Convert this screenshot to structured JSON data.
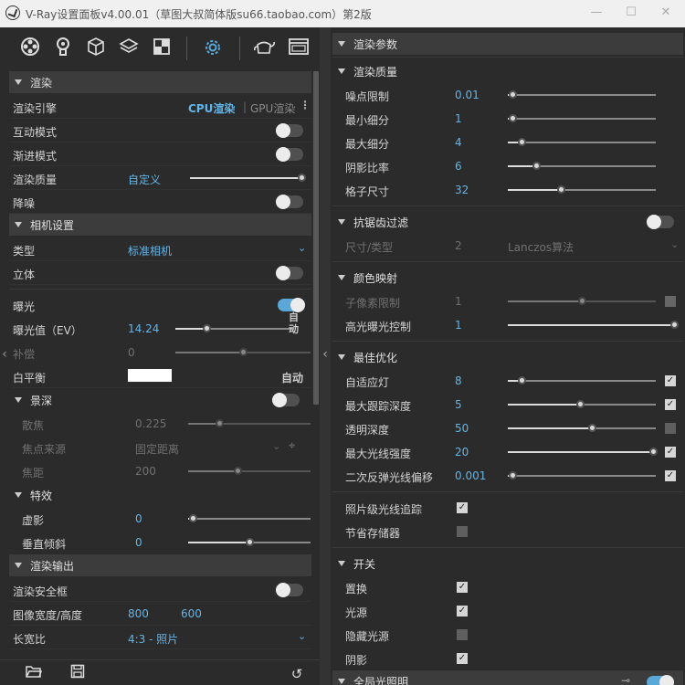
{
  "window": {
    "title": "V-Ray设置面板v4.00.01（草图大叔简体版su66.taobao.com）第2版",
    "minimize": "—",
    "maximize": "☐",
    "close": "✕"
  },
  "toolbar": {
    "icons": [
      "render-settings-icon",
      "light-bulb-icon",
      "cube-icon",
      "layers-icon",
      "texture-icon",
      "settings-gear-icon",
      "teapot-render-icon",
      "frame-buffer-icon"
    ]
  },
  "left": {
    "render": {
      "header": "渲染",
      "engine_label": "渲染引擎",
      "engine_cpu": "CPU渲染",
      "engine_gpu": "GPU渲染",
      "interactive_label": "互动模式",
      "progressive_label": "渐进模式",
      "quality_label": "渲染质量",
      "quality_value": "自定义",
      "quality_fraction": 1.0,
      "denoise_label": "降噪"
    },
    "camera": {
      "header": "相机设置",
      "type_label": "类型",
      "type_value": "标准相机",
      "stereo_label": "立体",
      "exposure_label": "曝光",
      "exposure_on": true,
      "ev_label": "曝光值（EV）",
      "ev_value": "14.24",
      "ev_fraction": 0.26,
      "ev_auto": "自\n动",
      "comp_label": "补偿",
      "comp_value": "0",
      "comp_fraction": 0.5,
      "wb_label": "白平衡",
      "wb_auto": "自动"
    },
    "dof": {
      "header": "景深",
      "aperture_label": "散焦",
      "aperture_value": "0.225",
      "aperture_fraction": 0.25,
      "focus_source_label": "焦点来源",
      "focus_source_value": "固定距离",
      "focus_dist_label": "焦距",
      "focus_dist_value": "200",
      "focus_dist_fraction": 0.4
    },
    "effects": {
      "header": "特效",
      "vignette_label": "虚影",
      "vignette_value": "0",
      "vignette_fraction": 0.04,
      "vtilt_label": "垂直倾斜",
      "vtilt_value": "0",
      "vtilt_fraction": 0.5
    },
    "output": {
      "header": "渲染输出",
      "safe_frame_label": "渲染安全框",
      "size_label": "图像宽度/高度",
      "width": "800",
      "height": "600",
      "aspect_label": "长宽比",
      "aspect_value": "4:3 - 照片"
    },
    "footer": {
      "icons": [
        "open-folder-icon",
        "save-icon",
        "reset-icon"
      ]
    }
  },
  "right": {
    "main_header": "渲染参数",
    "quality": {
      "header": "渲染质量",
      "rows": [
        {
          "label": "噪点限制",
          "value": "0.01",
          "fraction": 0.03
        },
        {
          "label": "最小细分",
          "value": "1",
          "fraction": 0.03
        },
        {
          "label": "最大细分",
          "value": "4",
          "fraction": 0.09
        },
        {
          "label": "阴影比率",
          "value": "6",
          "fraction": 0.19
        },
        {
          "label": "格子尺寸",
          "value": "32",
          "fraction": 0.36
        }
      ]
    },
    "aa": {
      "header": "抗锯齿过滤",
      "size_label": "尺寸/类型",
      "size_value": "2",
      "type_value": "Lanczos算法"
    },
    "color_mapping": {
      "header": "颜色映射",
      "subpixel_label": "子像素限制",
      "subpixel_value": "1",
      "subpixel_fraction": 0.5,
      "highlight_label": "高光曝光控制",
      "highlight_value": "1",
      "highlight_fraction": 1.0
    },
    "optimization": {
      "header": "最佳优化",
      "rows": [
        {
          "label": "自适应灯",
          "value": "8",
          "fraction": 0.09,
          "checked": true
        },
        {
          "label": "最大跟踪深度",
          "value": "5",
          "fraction": 0.49,
          "checked": true
        },
        {
          "label": "透明深度",
          "value": "50",
          "fraction": 0.57,
          "checked": false
        },
        {
          "label": "最大光线强度",
          "value": "20",
          "fraction": 0.98,
          "checked": true
        },
        {
          "label": "二次反弹光线偏移",
          "value": "0.001",
          "fraction": 0.03,
          "checked": true
        }
      ]
    },
    "misc": {
      "photon_label": "照片级光线追踪",
      "photon_checked": true,
      "save_mem_label": "节省存储器",
      "save_mem_checked": false
    },
    "switches": {
      "header": "开关",
      "rows": [
        {
          "label": "置换",
          "checked": true
        },
        {
          "label": "光源",
          "checked": true
        },
        {
          "label": "隐藏光源",
          "checked": false
        },
        {
          "label": "阴影",
          "checked": true
        }
      ]
    },
    "gi": {
      "header": "全局光照明"
    }
  },
  "colors": {
    "accent": "#63b5e8",
    "panel": "#2b2b2b",
    "header": "#3c3c3c",
    "toggle_on": "#5ba7d8"
  }
}
